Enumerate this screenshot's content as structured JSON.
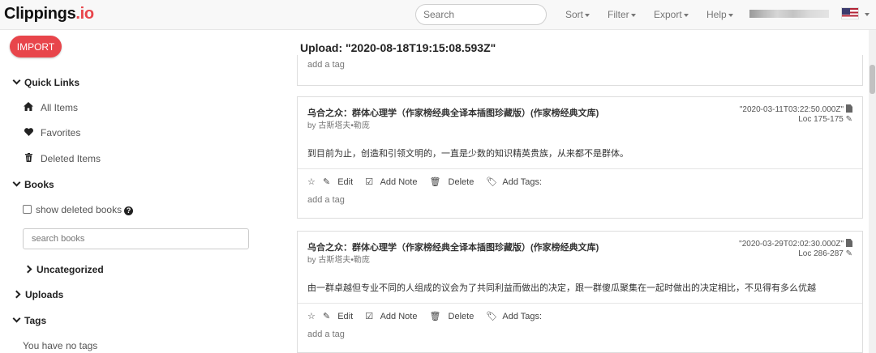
{
  "navbar": {
    "brand_main": "Clippings",
    "brand_suffix": ".io",
    "search_placeholder": "Search",
    "menus": [
      "Sort",
      "Filter",
      "Export",
      "Help"
    ]
  },
  "sidebar": {
    "import_label": "IMPORT",
    "quick_links_label": "Quick Links",
    "items": [
      {
        "label": "All Items",
        "icon": "home-icon"
      },
      {
        "label": "Favorites",
        "icon": "heart-icon"
      },
      {
        "label": "Deleted Items",
        "icon": "trash-icon"
      }
    ],
    "books_label": "Books",
    "show_deleted_label": "show deleted books",
    "search_books_placeholder": "search books",
    "uncategorized_label": "Uncategorized",
    "uploads_label": "Uploads",
    "tags_label": "Tags",
    "no_tags_label": "You have no tags"
  },
  "main": {
    "upload_title": "Upload: \"2020-08-18T19:15:08.593Z\"",
    "previous_tag_placeholder": "add a tag",
    "clippings": [
      {
        "title": "乌合之众：群体心理学（作家榜经典全译本插图珍藏版）(作家榜经典文库)",
        "author": "by 古斯塔夫•勒庞",
        "date": "\"2020-03-11T03:22:50.000Z\"",
        "loc": "Loc 175-175",
        "text": "到目前为止，创造和引领文明的，一直是少数的知识精英贵族，从来都不是群体。",
        "actions": {
          "edit": "Edit",
          "add_note": "Add Note",
          "delete": "Delete",
          "add_tags": "Add Tags:"
        },
        "tag_placeholder": "add a tag"
      },
      {
        "title": "乌合之众：群体心理学（作家榜经典全译本插图珍藏版）(作家榜经典文库)",
        "author": "by 古斯塔夫•勒庞",
        "date": "\"2020-03-29T02:02:30.000Z\"",
        "loc": "Loc 286-287",
        "text": "由一群卓越但专业不同的人组成的议会为了共同利益而做出的决定，跟一群傻瓜聚集在一起时做出的决定相比，不见得有多么优越",
        "actions": {
          "edit": "Edit",
          "add_note": "Add Note",
          "delete": "Delete",
          "add_tags": "Add Tags:"
        },
        "tag_placeholder": "add a tag"
      }
    ]
  },
  "colors": {
    "brand_accent": "#e8454b",
    "navbar_bg": "#f8f8f8"
  }
}
